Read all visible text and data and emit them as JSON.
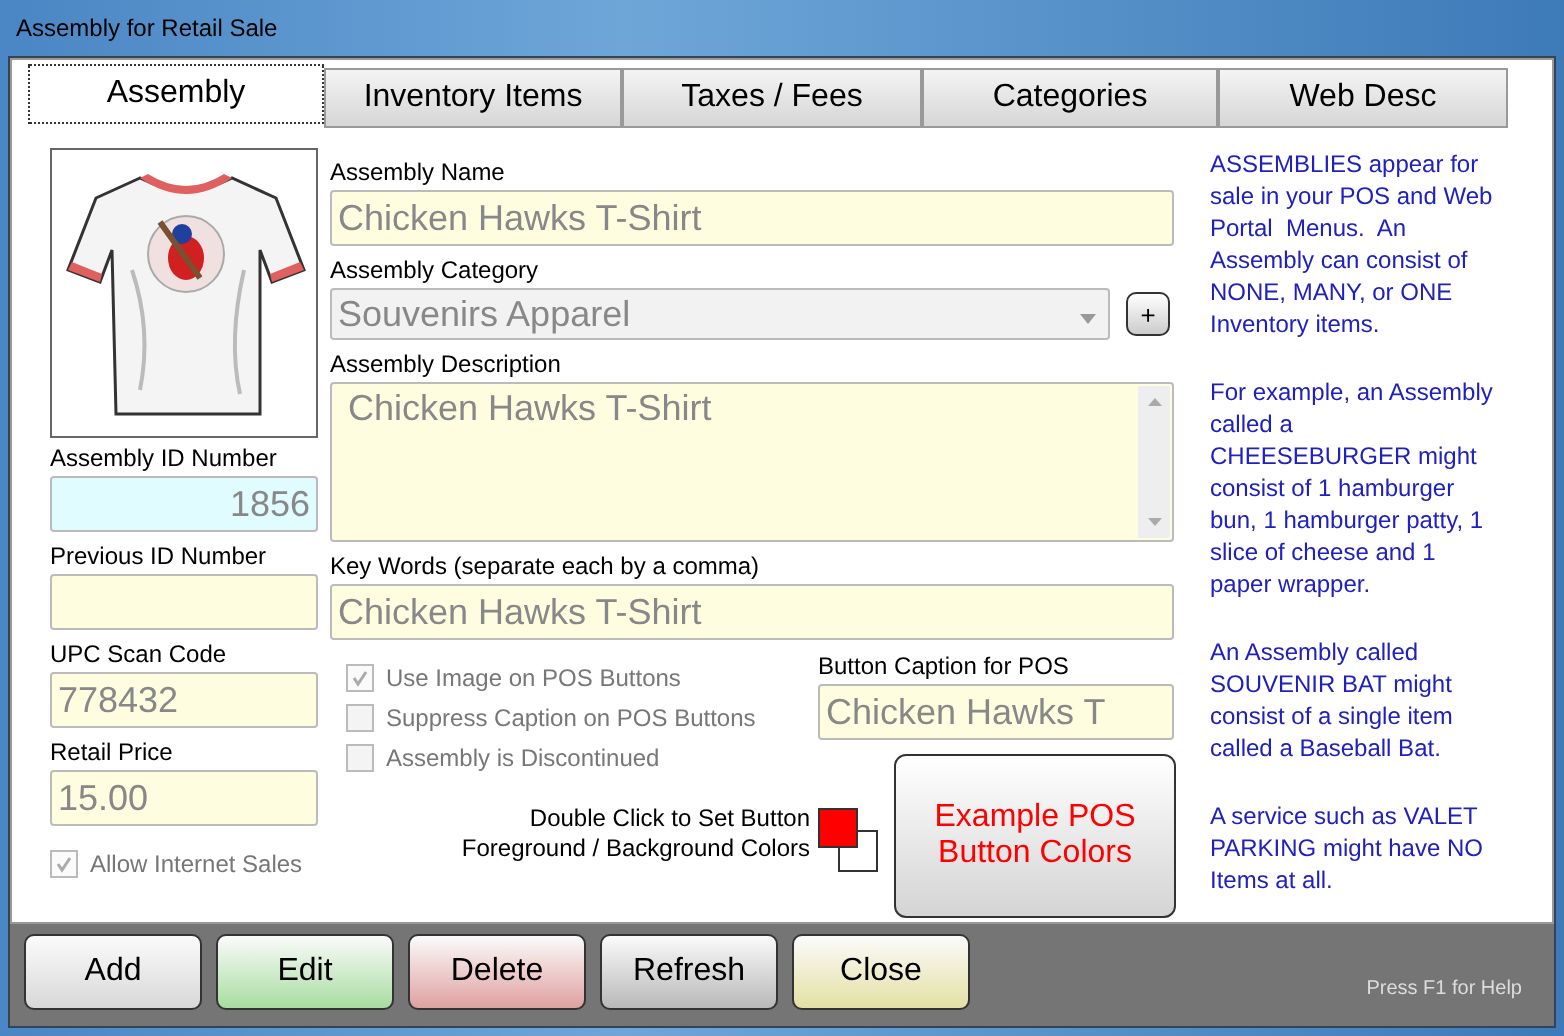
{
  "window": {
    "title": "Assembly for Retail Sale"
  },
  "tabs": [
    {
      "label": "Assembly",
      "selected": true
    },
    {
      "label": "Inventory Items",
      "selected": false
    },
    {
      "label": "Taxes  / Fees",
      "selected": false
    },
    {
      "label": "Categories",
      "selected": false
    },
    {
      "label": "Web Desc",
      "selected": false
    }
  ],
  "image": {
    "kind": "picture"
  },
  "left_fields": [
    {
      "label": "Assembly ID Number",
      "value": "1856",
      "kind": "id"
    },
    {
      "label": "Previous ID Number",
      "kind": "text"
    },
    {
      "label": "UPC Scan Code",
      "value": "778432",
      "kind": "text"
    },
    {
      "label": "Retail Price",
      "value": "15.00",
      "kind": "text"
    }
  ],
  "allow_internet_sales": {
    "label": "Allow Internet Sales",
    "checked": true
  },
  "assembly_name": {
    "label": "Assembly Name",
    "value": "Chicken Hawks T-Shirt"
  },
  "category": {
    "label": "Assembly Category",
    "value": "Souvenirs Apparel",
    "add_button": "+"
  },
  "description": {
    "label": "Assembly Description",
    "value": "Chicken Hawks T-Shirt"
  },
  "keywords": {
    "label": "Key Words (separate each by a comma)",
    "value": "Chicken Hawks T-Shirt"
  },
  "options": [
    {
      "label": "Use Image on POS Buttons",
      "checked": true
    },
    {
      "label": "Suppress Caption on POS Buttons",
      "checked": false
    },
    {
      "label": "Assembly is Discontinued",
      "checked": false
    }
  ],
  "button_caption": {
    "label": "Button Caption for POS",
    "value": "Chicken Hawks T"
  },
  "color_hint": "Double Click to Set Button Foreground / Background Colors",
  "button_colors": [
    {
      "color": "#ff0000"
    },
    {
      "color": "#ffffff"
    }
  ],
  "example_button": "Example POS Button Colors",
  "help": [
    "ASSEMBLIES appear for sale in your POS and Web Portal  Menus.  An Assembly can consist of NONE, MANY, or ONE Inventory items.",
    "For example, an Assembly called a CHEESEBURGER might consist of 1 hamburger bun, 1 hamburger patty, 1 slice of cheese and 1 paper wrapper.",
    "An Assembly called SOUVENIR BAT might consist of a single item called a Baseball Bat.",
    "A service such as VALET PARKING might have NO Items at all."
  ],
  "actions": [
    {
      "label": "Add",
      "color": "#d8d8d8"
    },
    {
      "label": "Edit",
      "color": "#a8dca0"
    },
    {
      "label": "Delete",
      "color": "#e0a0a0"
    },
    {
      "label": "Refresh",
      "color": "#b8b8b8"
    },
    {
      "label": "Close",
      "color": "#e4e0a4"
    }
  ],
  "status": "Press F1 for Help"
}
